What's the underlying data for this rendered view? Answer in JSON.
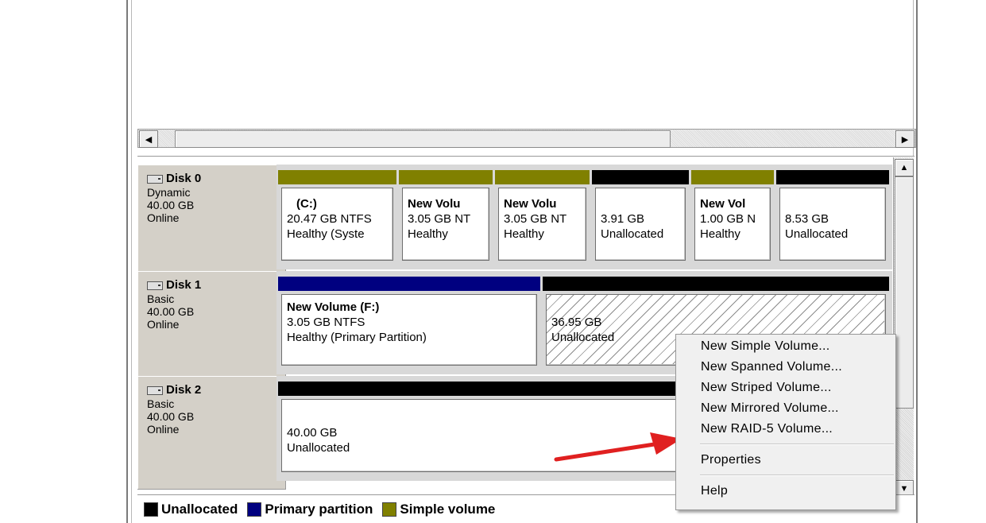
{
  "disks": [
    {
      "name": "Disk 0",
      "type": "Dynamic",
      "size": "40.00 GB",
      "status": "Online",
      "partitions": [
        {
          "title": "(C:)",
          "line2": "20.47 GB NTFS",
          "line3": "Healthy (Syste",
          "bar_color": "#808000"
        },
        {
          "title": "New Volu",
          "line2": "3.05 GB NT",
          "line3": "Healthy",
          "bar_color": "#808000"
        },
        {
          "title": "New Volu",
          "line2": "3.05 GB NT",
          "line3": "Healthy",
          "bar_color": "#808000"
        },
        {
          "title": "",
          "line2": "3.91 GB",
          "line3": "Unallocated",
          "bar_color": "#000000"
        },
        {
          "title": "New Vol",
          "line2": "1.00 GB N",
          "line3": "Healthy",
          "bar_color": "#808000"
        },
        {
          "title": "",
          "line2": "8.53 GB",
          "line3": "Unallocated",
          "bar_color": "#000000"
        }
      ]
    },
    {
      "name": "Disk 1",
      "type": "Basic",
      "size": "40.00 GB",
      "status": "Online",
      "partitions": [
        {
          "title": "New Volume  (F:)",
          "line2": "3.05 GB NTFS",
          "line3": "Healthy (Primary Partition)",
          "bar_color": "#000080"
        },
        {
          "title": "",
          "line2": "36.95 GB",
          "line3": "Unallocated",
          "bar_color": "#000000"
        }
      ]
    },
    {
      "name": "Disk 2",
      "type": "Basic",
      "size": "40.00 GB",
      "status": "Online",
      "partitions": [
        {
          "title": "",
          "line2": "40.00 GB",
          "line3": "Unallocated",
          "bar_color": "#000000"
        }
      ]
    }
  ],
  "legend": [
    {
      "label": "Unallocated",
      "color": "#000000"
    },
    {
      "label": "Primary partition",
      "color": "#000080"
    },
    {
      "label": "Simple volume",
      "color": "#808000"
    }
  ],
  "context_menu": {
    "items": [
      "New Simple Volume...",
      "New Spanned Volume...",
      "New Striped Volume...",
      "New Mirrored Volume...",
      "New RAID-5 Volume..."
    ],
    "properties": "Properties",
    "help": "Help"
  },
  "annotation_arrow_color": "#e02020"
}
